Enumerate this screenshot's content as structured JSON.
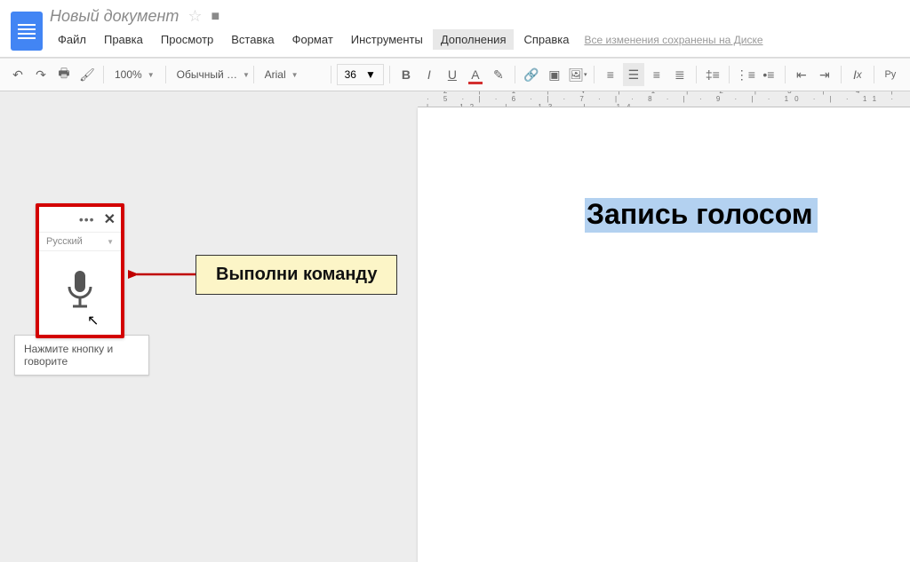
{
  "header": {
    "title": "Новый документ",
    "save_status": "Все изменения сохранены на Диске"
  },
  "menu": [
    "Файл",
    "Правка",
    "Просмотр",
    "Вставка",
    "Формат",
    "Инструменты",
    "Дополнения",
    "Справка"
  ],
  "menu_active": 6,
  "toolbar": {
    "zoom": "100%",
    "style": "Обычный …",
    "font": "Arial",
    "fontsize": "36"
  },
  "ruler": "· 2 · | · 1 · | · ▼ · | · 1 · | · 2 · | · 3 · | · 4 · | · 5 · | · 6 · | · 7 · | · 8 · | · 9 · | · 10 · | · 11 · | · 12 · | · 13 · | · 14",
  "page": {
    "text": "Запись голосом"
  },
  "voice": {
    "language": "Русский",
    "tooltip": "Нажмите кнопку и говорите"
  },
  "callout": "Выполни команду"
}
